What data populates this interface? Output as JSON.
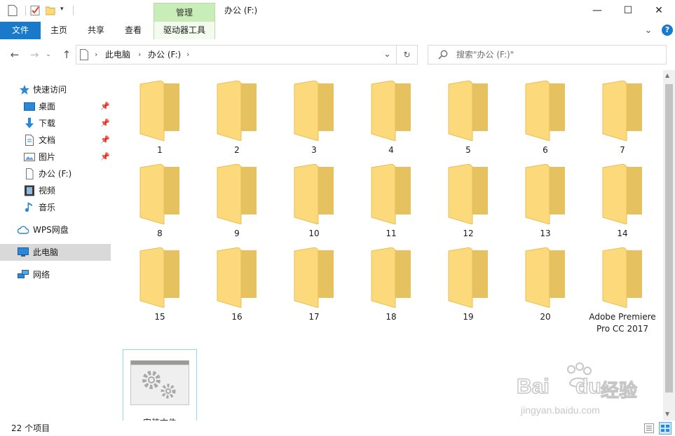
{
  "titlebar": {
    "context_tab": "管理",
    "window_title": "办公 (F:)",
    "minimize_glyph": "—",
    "maximize_glyph": "☐",
    "close_glyph": "✕"
  },
  "ribbon": {
    "tabs": [
      "文件",
      "主页",
      "共享",
      "查看",
      "驱动器工具"
    ],
    "collapse_glyph": "⌄",
    "help_glyph": "?"
  },
  "address": {
    "crumbs": [
      "此电脑",
      "办公 (F:)"
    ],
    "dropdown_glyph": "⌄",
    "refresh_glyph": "↻"
  },
  "search": {
    "placeholder": "搜索\"办公 (F:)\""
  },
  "sidebar": {
    "items": [
      {
        "label": "快速访问",
        "icon": "star-icon"
      },
      {
        "label": "桌面",
        "icon": "desktop-icon",
        "pinned": true
      },
      {
        "label": "下载",
        "icon": "download-icon",
        "pinned": true
      },
      {
        "label": "文档",
        "icon": "document-icon",
        "pinned": true
      },
      {
        "label": "图片",
        "icon": "picture-icon",
        "pinned": true
      },
      {
        "label": "办公 (F:)",
        "icon": "drive-icon"
      },
      {
        "label": "视频",
        "icon": "video-icon"
      },
      {
        "label": "音乐",
        "icon": "music-icon"
      },
      {
        "label": "WPS网盘",
        "icon": "cloud-icon"
      },
      {
        "label": "此电脑",
        "icon": "computer-icon",
        "selected": true
      },
      {
        "label": "网络",
        "icon": "network-icon"
      }
    ]
  },
  "files": {
    "folders": [
      "1",
      "2",
      "3",
      "4",
      "5",
      "6",
      "7",
      "8",
      "9",
      "10",
      "11",
      "12",
      "13",
      "14",
      "15",
      "16",
      "17",
      "18",
      "19",
      "20",
      "Adobe Premiere Pro CC 2017"
    ],
    "exe_label": "安装文件"
  },
  "status": {
    "count_text": "22 个项目"
  },
  "watermark": {
    "brand": "Bai",
    "brand2": "du",
    "cn": "经验",
    "url": "jingyan.baidu.com"
  },
  "colors": {
    "accent": "#1979ca",
    "context_tab": "#c9edb6",
    "folder_back": "#e6c15f",
    "folder_front": "#fcd97a",
    "selection": "#d9d9d9"
  }
}
